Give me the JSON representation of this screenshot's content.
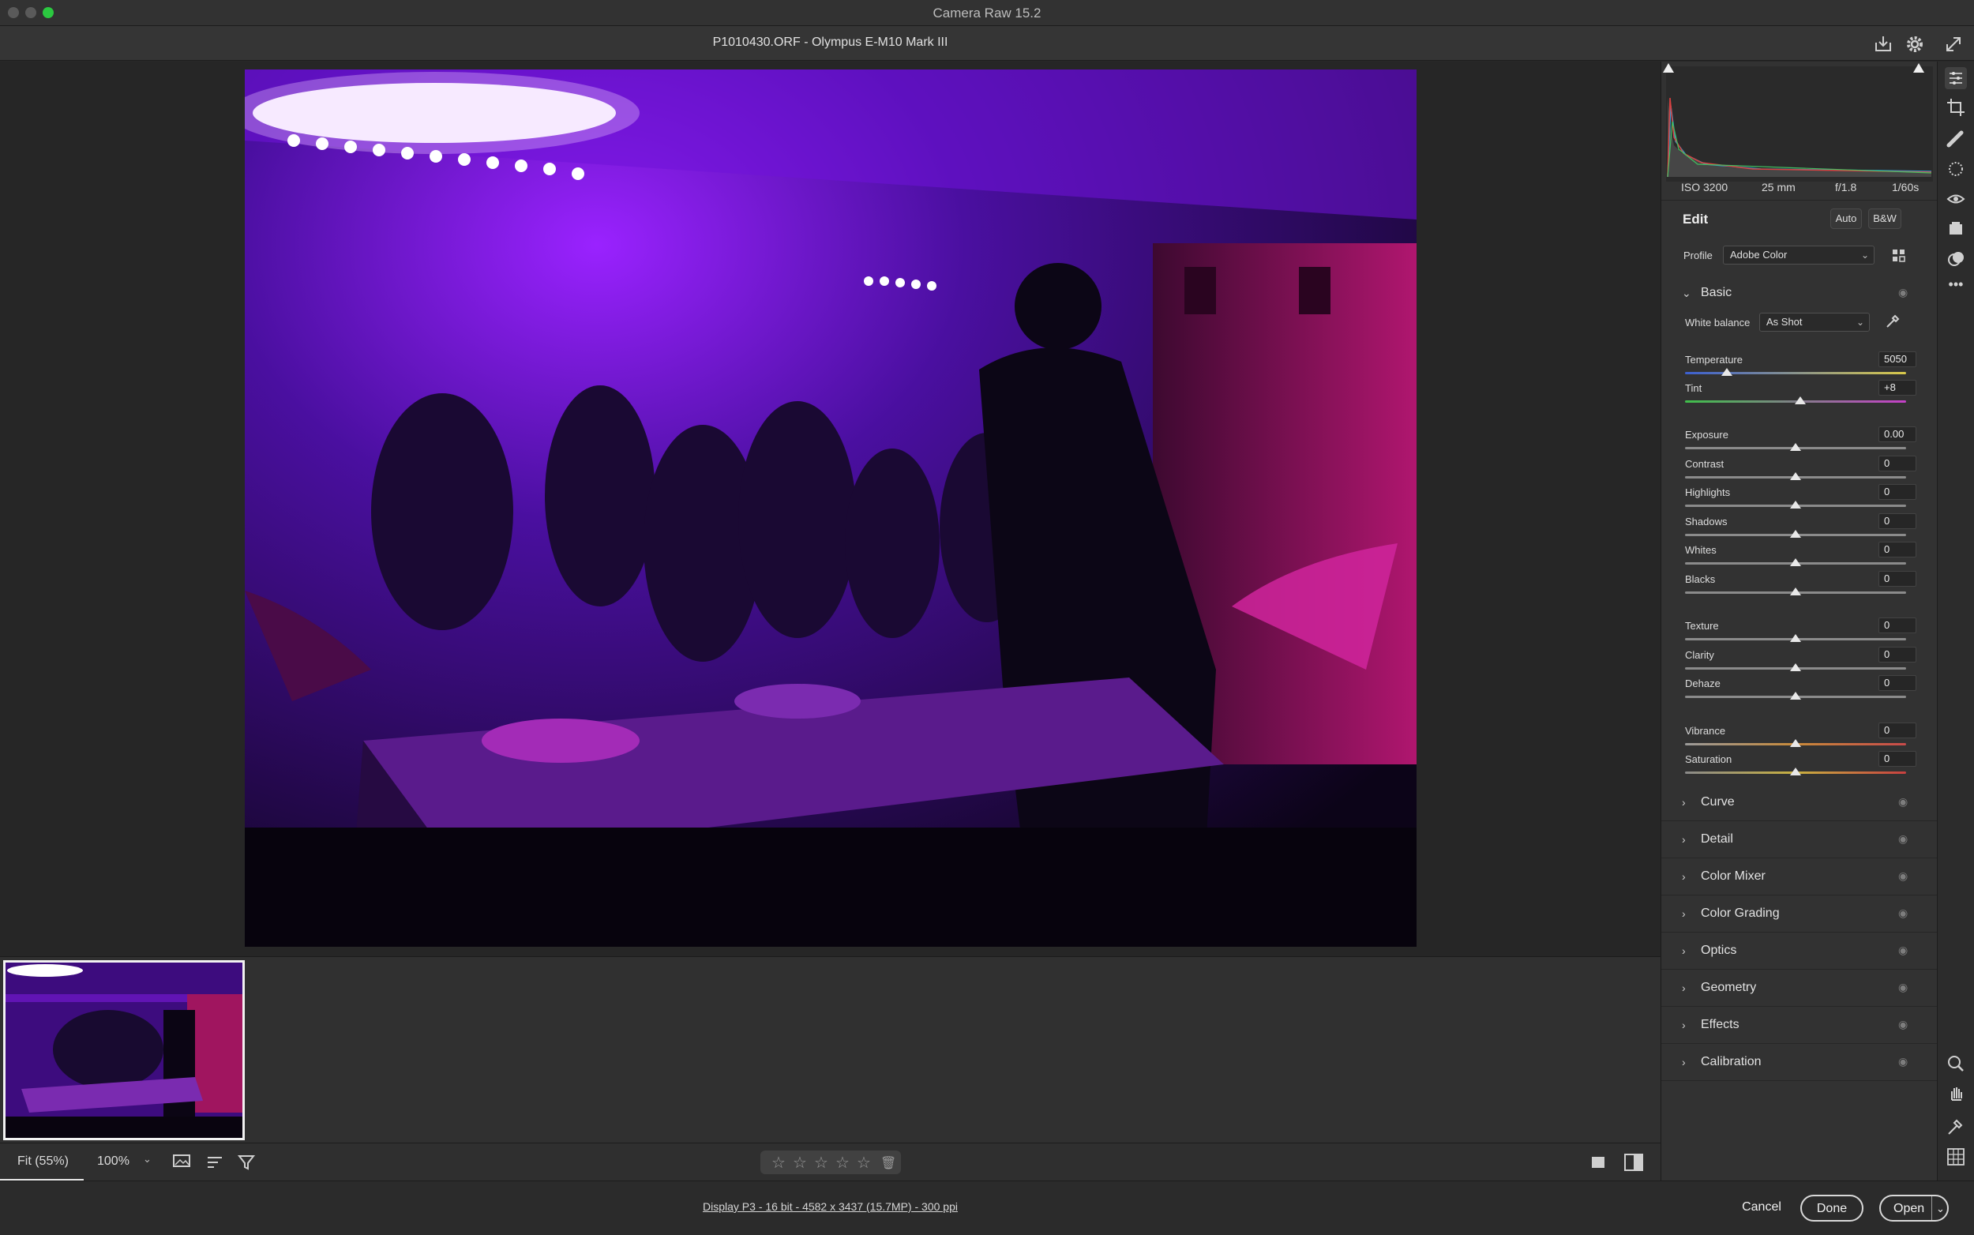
{
  "window": {
    "title": "Camera Raw 15.2"
  },
  "header": {
    "file_label": "P1010430.ORF  -  Olympus E-M10 Mark III"
  },
  "exif": {
    "iso": "ISO 3200",
    "focal": "25 mm",
    "aperture": "f/1.8",
    "shutter": "1/60s"
  },
  "edit": {
    "title": "Edit",
    "auto_label": "Auto",
    "bw_label": "B&W",
    "profile_label": "Profile",
    "profile_value": "Adobe Color"
  },
  "basic": {
    "title": "Basic",
    "white_balance_label": "White balance",
    "white_balance_value": "As Shot",
    "sliders": [
      {
        "label": "Temperature",
        "value": "5050",
        "pos": 0.19
      },
      {
        "label": "Tint",
        "value": "+8",
        "pos": 0.52
      },
      {
        "label": "Exposure",
        "value": "0.00",
        "pos": 0.5
      },
      {
        "label": "Contrast",
        "value": "0",
        "pos": 0.5
      },
      {
        "label": "Highlights",
        "value": "0",
        "pos": 0.5
      },
      {
        "label": "Shadows",
        "value": "0",
        "pos": 0.5
      },
      {
        "label": "Whites",
        "value": "0",
        "pos": 0.5
      },
      {
        "label": "Blacks",
        "value": "0",
        "pos": 0.5
      },
      {
        "label": "Texture",
        "value": "0",
        "pos": 0.5
      },
      {
        "label": "Clarity",
        "value": "0",
        "pos": 0.5
      },
      {
        "label": "Dehaze",
        "value": "0",
        "pos": 0.5
      },
      {
        "label": "Vibrance",
        "value": "0",
        "pos": 0.5
      },
      {
        "label": "Saturation",
        "value": "0",
        "pos": 0.5
      }
    ]
  },
  "sections": [
    "Curve",
    "Detail",
    "Color Mixer",
    "Color Grading",
    "Optics",
    "Geometry",
    "Effects",
    "Calibration"
  ],
  "toolbar": {
    "fit_label": "Fit (55%)",
    "zoom_value": "100%"
  },
  "footer": {
    "info": "Display P3 - 16 bit - 4582 x 3437 (15.7MP) - 300 ppi",
    "cancel": "Cancel",
    "done": "Done",
    "open": "Open"
  },
  "colors": {
    "accent": "#ffffff",
    "photo_tint": "#7a1bd9",
    "magenta": "#d0259c"
  }
}
